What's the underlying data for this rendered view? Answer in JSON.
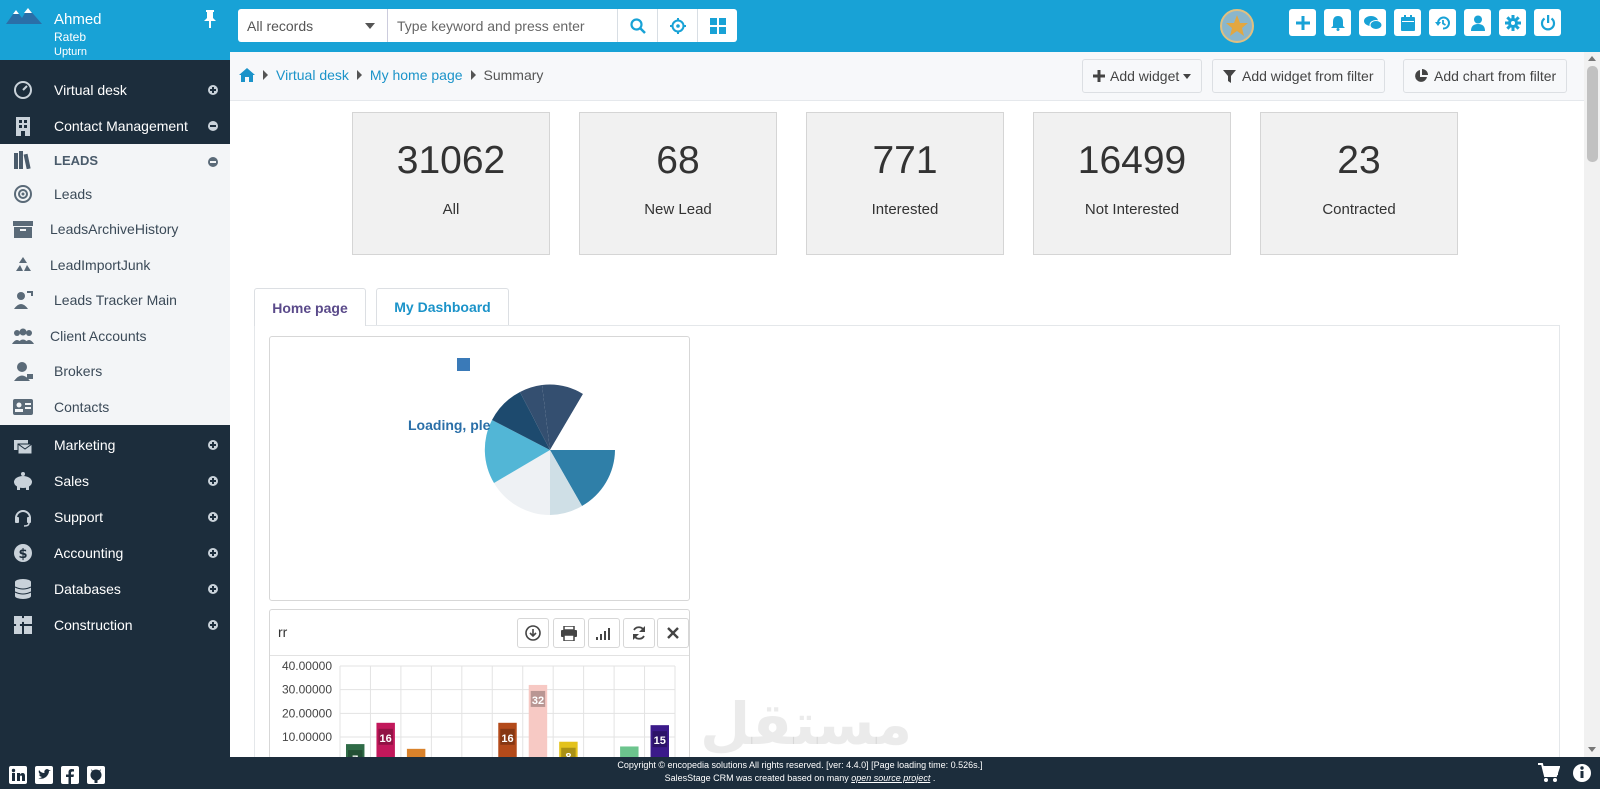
{
  "user": {
    "name": "Ahmed",
    "line2": "Rateb",
    "line3": "Upturn"
  },
  "sidebar": {
    "items": [
      {
        "label": "Virtual desk",
        "icon": "speedometer-icon",
        "state": "plus"
      },
      {
        "label": "Contact Management",
        "icon": "building-icon",
        "state": "minus"
      }
    ],
    "leads_head": {
      "label": "LEADS",
      "icon": "books-icon",
      "state": "minus"
    },
    "sub_items": [
      {
        "label": "Leads",
        "icon": "target-icon"
      },
      {
        "label": "LeadsArchiveHistory",
        "icon": "archive-icon"
      },
      {
        "label": "LeadImportJunk",
        "icon": "recycle-icon"
      },
      {
        "label": "Leads Tracker Main",
        "icon": "user-tracker-icon"
      },
      {
        "label": "Client Accounts",
        "icon": "users-icon"
      },
      {
        "label": "Brokers",
        "icon": "user-tie-icon"
      },
      {
        "label": "Contacts",
        "icon": "id-card-icon"
      }
    ],
    "bottom_items": [
      {
        "label": "Marketing",
        "icon": "mail-bulk-icon",
        "state": "plus"
      },
      {
        "label": "Sales",
        "icon": "piggy-bank-icon",
        "state": "plus"
      },
      {
        "label": "Support",
        "icon": "headset-icon",
        "state": "plus"
      },
      {
        "label": "Accounting",
        "icon": "dollar-icon",
        "state": "plus"
      },
      {
        "label": "Databases",
        "icon": "database-icon",
        "state": "plus"
      },
      {
        "label": "Construction",
        "icon": "puzzle-icon",
        "state": "plus"
      }
    ]
  },
  "topbar": {
    "records_select": "All records",
    "search_placeholder": "Type keyword and press enter",
    "icons": [
      "plus-icon",
      "bell-icon",
      "comments-icon",
      "calendar-icon",
      "history-icon",
      "user-icon",
      "gear-icon",
      "power-icon"
    ]
  },
  "breadcrumb": {
    "items": [
      "Virtual desk",
      "My home page"
    ],
    "current": "Summary"
  },
  "actions": {
    "add_widget": "Add widget",
    "add_widget_filter": "Add widget from filter",
    "add_chart_filter": "Add chart from filter"
  },
  "stats": [
    {
      "value": "31062",
      "label": "All"
    },
    {
      "value": "68",
      "label": "New Lead"
    },
    {
      "value": "771",
      "label": "Interested"
    },
    {
      "value": "16499",
      "label": "Not Interested"
    },
    {
      "value": "23",
      "label": "Contracted"
    }
  ],
  "tabs": [
    {
      "label": "Home page",
      "active": true,
      "color": "#5a4a8a"
    },
    {
      "label": "My Dashboard",
      "active": false,
      "color": "#1b93c9"
    }
  ],
  "widget1": {
    "loading_text": "Loading, ple"
  },
  "widget2": {
    "title": "rr",
    "buttons": [
      "download-icon",
      "print-icon",
      "signal-icon",
      "refresh-icon",
      "close-icon"
    ]
  },
  "chart_data": {
    "type": "bar",
    "ylim": [
      0,
      40
    ],
    "ytick_labels": [
      "40.00000",
      "30.00000",
      "20.00000",
      "10.00000"
    ],
    "bars": [
      {
        "value": 7,
        "label": "7",
        "color": "#2f6b47"
      },
      {
        "value": 16,
        "label": "16",
        "color": "#c2185b"
      },
      {
        "value": 5,
        "label": "",
        "color": "#d9822b"
      },
      {
        "value": 0,
        "label": "",
        "color": "#ffffff"
      },
      {
        "value": 0,
        "label": "",
        "color": "#ffffff"
      },
      {
        "value": 16,
        "label": "16",
        "color": "#b34a1a"
      },
      {
        "value": 32,
        "label": "32",
        "color": "#f7c9c4"
      },
      {
        "value": 8,
        "label": "8",
        "color": "#e3c21c"
      },
      {
        "value": 0,
        "label": "",
        "color": "#ffffff"
      },
      {
        "value": 6,
        "label": "",
        "color": "#6cc48d"
      },
      {
        "value": 15,
        "label": "15",
        "color": "#3b1a8a"
      }
    ]
  },
  "footer": {
    "line1": "Copyright © encopedia solutions All rights reserved. [ver: 4.4.0] [Page loading time: 0.526s.]",
    "line2_prefix": "SalesStage CRM was created based on many",
    "line2_link": "open source project",
    "line2_suffix": "."
  },
  "watermark": "مستقل"
}
